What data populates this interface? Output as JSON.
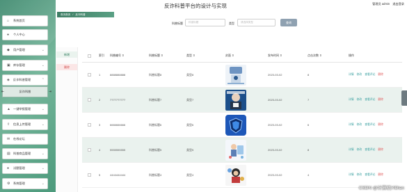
{
  "header": {
    "title": "反诈科普平台的设计与实现",
    "user_label": "管理员 admin",
    "exit_label": "退出登录"
  },
  "sidebar": {
    "items": [
      {
        "label": "系统首页",
        "icon": "home-icon"
      },
      {
        "label": "个人中心",
        "icon": "user-icon"
      },
      {
        "label": "用户管理",
        "icon": "users-icon"
      },
      {
        "label": "库存管理",
        "icon": "box-icon"
      },
      {
        "label": "反诈科普管理",
        "icon": "shield-icon"
      },
      {
        "label": "一键举报管理",
        "icon": "report-icon"
      },
      {
        "label": "信息上传管理",
        "icon": "upload-icon"
      },
      {
        "label": "在线论坛",
        "icon": "forum-icon"
      },
      {
        "label": "科普商品管理",
        "icon": "shop-icon"
      },
      {
        "label": "试题管理",
        "icon": "question-icon"
      },
      {
        "label": "系统管理",
        "icon": "settings-icon"
      }
    ],
    "submenu": {
      "label": "反诈科普"
    }
  },
  "breadcrumb": {
    "home": "首页首页",
    "sep": "/",
    "current": "反诈科普"
  },
  "search": {
    "title_label": "科普标题",
    "title_placeholder": "科普标题",
    "type_label": "类型",
    "type_placeholder": "请选择类型",
    "button": "查询"
  },
  "actions": {
    "add": "新增",
    "delete": "删除"
  },
  "table": {
    "headers": [
      "索引",
      "科普编号",
      "科普标题",
      "类型",
      "封面",
      "发布时间",
      "点击次数",
      "操作"
    ],
    "sort_mark": "⇕",
    "ops": {
      "detail": "详情",
      "edit": "修改",
      "comments": "查看评论",
      "delete": "删除"
    },
    "rows": [
      {
        "index": "1",
        "code": "8888888888",
        "title": "科普标题8",
        "type": "类型8",
        "date": "2023-03-02",
        "clicks": "8"
      },
      {
        "index": "2",
        "code": "7777777777",
        "title": "科普标题7",
        "type": "类型7",
        "date": "2023-03-02",
        "clicks": "7"
      },
      {
        "index": "3",
        "code": "6666666666",
        "title": "科普标题6",
        "type": "类型6",
        "date": "2023-03-02",
        "clicks": "6"
      },
      {
        "index": "4",
        "code": "5555555555",
        "title": "科普标题5",
        "type": "类型5",
        "date": "2023-03-02",
        "clicks": "8"
      },
      {
        "index": "5",
        "code": "4444444444",
        "title": "科普标题4",
        "type": "类型4",
        "date": "2023-03-02",
        "clicks": "4"
      }
    ]
  },
  "watermark": "CSDN @计算机YiDian",
  "colors": {
    "accent": "#4c9a7c",
    "danger": "#e05a5a",
    "link": "#3aa0a0"
  }
}
